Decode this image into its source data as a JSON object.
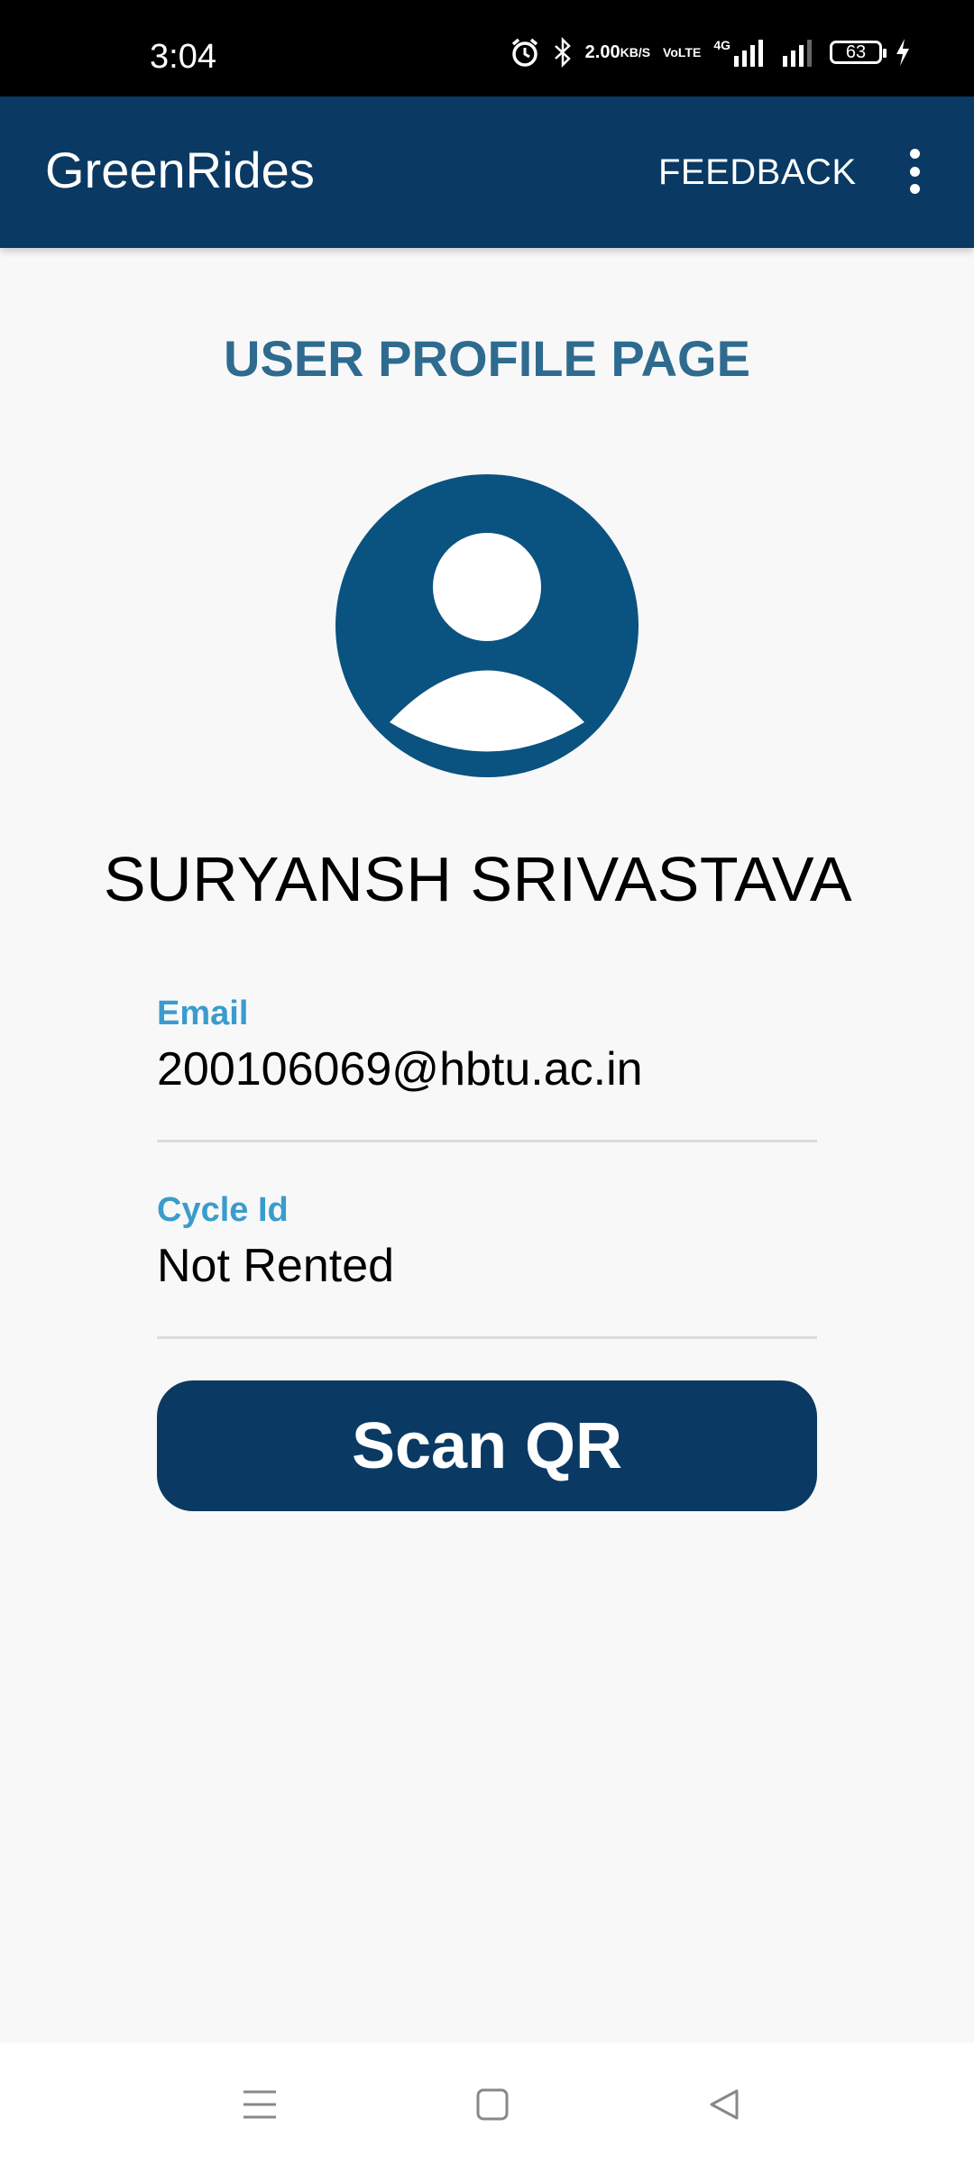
{
  "status_bar": {
    "time": "3:04",
    "net_speed": "2.00",
    "net_speed_unit": "KB/S",
    "volte_top": "Vo",
    "volte_bottom": "LTE",
    "network": "4G",
    "battery": "63",
    "icons": [
      "alarm-icon",
      "bluetooth-icon",
      "signal-icon",
      "charging-icon"
    ]
  },
  "app_bar": {
    "title": "GreenRides",
    "feedback_label": "FEEDBACK",
    "overflow_icon": "more-vertical-icon"
  },
  "profile": {
    "heading": "USER PROFILE PAGE",
    "avatar_icon": "account-circle-icon",
    "name": "SURYANSH SRIVASTAVA",
    "email_label": "Email",
    "email_value": "200106069@hbtu.ac.in",
    "cycle_label": "Cycle Id",
    "cycle_value": "Not Rented",
    "scan_button_label": "Scan QR"
  },
  "nav_bar": {
    "icons": [
      "menu-icon",
      "home-square-icon",
      "back-triangle-icon"
    ]
  },
  "colors": {
    "primary": "#0a3a63",
    "heading": "#2e6b8f",
    "label": "#3a9ccc",
    "avatar": "#0a5280",
    "background": "#f8f8f9"
  }
}
